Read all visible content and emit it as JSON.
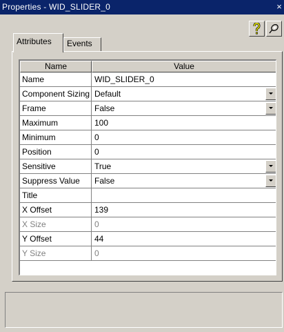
{
  "window": {
    "title": "Properties - WID_SLIDER_0",
    "close_glyph": "×"
  },
  "toolbar": {
    "help_icon": "help-question-icon",
    "pin_icon": "pin-icon"
  },
  "tabs": [
    {
      "label": "Attributes",
      "active": true
    },
    {
      "label": "Events",
      "active": false
    }
  ],
  "grid": {
    "columns": [
      "Name",
      "Value"
    ],
    "rows": [
      {
        "name": "Name",
        "value": "WID_SLIDER_0",
        "dropdown": false,
        "disabled": false
      },
      {
        "name": "Component Sizing",
        "value": "Default",
        "dropdown": true,
        "disabled": false
      },
      {
        "name": "Frame",
        "value": "False",
        "dropdown": true,
        "disabled": false
      },
      {
        "name": "Maximum",
        "value": "100",
        "dropdown": false,
        "disabled": false
      },
      {
        "name": "Minimum",
        "value": "0",
        "dropdown": false,
        "disabled": false
      },
      {
        "name": "Position",
        "value": "0",
        "dropdown": false,
        "disabled": false
      },
      {
        "name": "Sensitive",
        "value": "True",
        "dropdown": true,
        "disabled": false
      },
      {
        "name": "Suppress Value",
        "value": "False",
        "dropdown": true,
        "disabled": false
      },
      {
        "name": "Title",
        "value": "",
        "dropdown": false,
        "disabled": false
      },
      {
        "name": "X Offset",
        "value": "139",
        "dropdown": false,
        "disabled": false
      },
      {
        "name": "X Size",
        "value": "0",
        "dropdown": false,
        "disabled": true
      },
      {
        "name": "Y Offset",
        "value": "44",
        "dropdown": false,
        "disabled": false
      },
      {
        "name": "Y Size",
        "value": "0",
        "dropdown": false,
        "disabled": true
      }
    ]
  },
  "statusbar": {
    "text": ""
  },
  "colors": {
    "titlebar": "#0a246a",
    "face": "#d4d0c8",
    "disabled_text": "#808080"
  }
}
